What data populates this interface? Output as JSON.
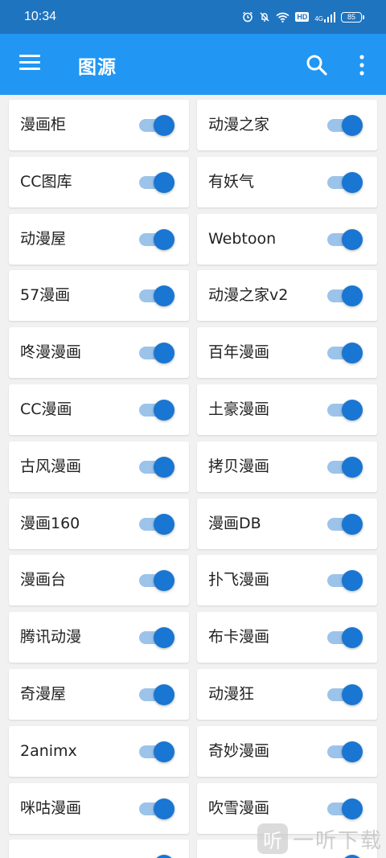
{
  "status_bar": {
    "time": "10:34",
    "icons": [
      "alarm-icon",
      "mute-icon",
      "wifi-icon",
      "hd-icon",
      "4g-signal-icon",
      "battery-icon"
    ],
    "hd_label": "HD",
    "network_label": "4G",
    "battery": "85"
  },
  "appbar": {
    "title": "图源",
    "icons": [
      "menu-icon",
      "search-icon",
      "more-vert-icon"
    ],
    "color": "#2196f3"
  },
  "sources": [
    {
      "name": "漫画柜",
      "enabled": true
    },
    {
      "name": "动漫之家",
      "enabled": true
    },
    {
      "name": "CC图库",
      "enabled": true
    },
    {
      "name": "有妖气",
      "enabled": true
    },
    {
      "name": "动漫屋",
      "enabled": true
    },
    {
      "name": "Webtoon",
      "enabled": true
    },
    {
      "name": "57漫画",
      "enabled": true
    },
    {
      "name": "动漫之家v2",
      "enabled": true
    },
    {
      "name": "咚漫漫画",
      "enabled": true
    },
    {
      "name": "百年漫画",
      "enabled": true
    },
    {
      "name": "CC漫画",
      "enabled": true
    },
    {
      "name": "土豪漫画",
      "enabled": true
    },
    {
      "name": "古风漫画",
      "enabled": true
    },
    {
      "name": "拷贝漫画",
      "enabled": true
    },
    {
      "name": "漫画160",
      "enabled": true
    },
    {
      "name": "漫画DB",
      "enabled": true
    },
    {
      "name": "漫画台",
      "enabled": true
    },
    {
      "name": "扑飞漫画",
      "enabled": true
    },
    {
      "name": "腾讯动漫",
      "enabled": true
    },
    {
      "name": "布卡漫画",
      "enabled": true
    },
    {
      "name": "奇漫屋",
      "enabled": true
    },
    {
      "name": "动漫狂",
      "enabled": true
    },
    {
      "name": "2animx",
      "enabled": true
    },
    {
      "name": "奇妙漫画",
      "enabled": true
    },
    {
      "name": "咪咕漫画",
      "enabled": true
    },
    {
      "name": "吹雪漫画",
      "enabled": true
    },
    {
      "name": "",
      "enabled": true
    },
    {
      "name": "",
      "enabled": true
    }
  ],
  "switch_colors": {
    "thumb": "#1976d2",
    "track": "#9cc3ea"
  },
  "watermark": {
    "logo_char": "听",
    "text": "一听下载"
  }
}
